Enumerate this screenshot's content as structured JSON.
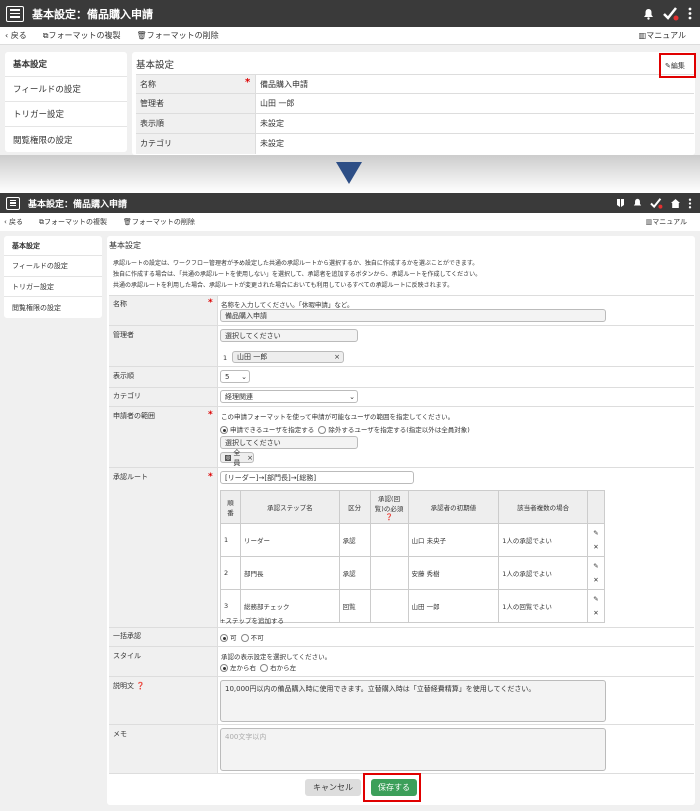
{
  "top": {
    "title": "基本設定：備品購入申請",
    "toolbar": {
      "back": "戻る",
      "copy": "フォーマットの複製",
      "delete": "フォーマットの削除",
      "manual": "マニュアル"
    },
    "sidebar": [
      "基本設定",
      "フィールドの設定",
      "トリガー設定",
      "閲覧権限の設定"
    ],
    "section_title": "基本設定",
    "edit": "編集",
    "rows": [
      {
        "label": "名称",
        "value": "備品購入申請"
      },
      {
        "label": "管理者",
        "value": "山田 一郎"
      },
      {
        "label": "表示順",
        "value": "未設定"
      },
      {
        "label": "カテゴリ",
        "value": "未設定"
      }
    ]
  },
  "bottom": {
    "title": "基本設定：備品購入申請",
    "toolbar": {
      "back": "戻る",
      "copy": "フォーマットの複製",
      "delete": "フォーマットの削除",
      "manual": "マニュアル"
    },
    "sidebar": [
      "基本設定",
      "フィールドの設定",
      "トリガー設定",
      "閲覧権限の設定"
    ],
    "section_title": "基本設定",
    "intro": [
      "承認ルートの設定は、ワークフロー管理者が予め設定した共通の承認ルートから選択するか、独自に作成するかを選ぶことができます。",
      "独自に作成する場合は、「共通の承認ルートを使用しない」を選択して、承認者を追加するボタンから、承認ルートを作成してください。",
      "共通の承認ルートを利用した場合、承認ルートが変更された場合においても利用しているすべての承認ルートに反映されます。"
    ],
    "name": {
      "label": "名称",
      "hint": "名称を入力してください。「休暇申請」など。",
      "value": "備品購入申請"
    },
    "admin": {
      "label": "管理者",
      "placeholder": "選択してください",
      "num": "1",
      "person": "山田 一郎"
    },
    "order": {
      "label": "表示順",
      "value": "5"
    },
    "category": {
      "label": "カテゴリ",
      "value": "経理関連"
    },
    "scope": {
      "label": "申請者の範囲",
      "hint": "この申請フォーマットを使って申請が可能なユーザの範囲を指定してください。",
      "opt1": "申請できるユーザを指定する",
      "opt2": "除外するユーザを指定する(指定以外は全員対象)",
      "placeholder": "選択してください",
      "chip": "全員"
    },
    "route": {
      "label": "承認ルート",
      "value": "[リーダー]→[部門長]→[総務]",
      "headers": [
        "順番",
        "承認ステップ名",
        "区分",
        "承認(回覧)の必須",
        "承認者の初期値",
        "該当者複数の場合"
      ],
      "steps": [
        {
          "no": "1",
          "name": "リーダー",
          "type": "承認",
          "approver": "山口 未央子",
          "multi": "1人の承認でよい"
        },
        {
          "no": "2",
          "name": "部門長",
          "type": "承認",
          "approver": "安藤 秀樹",
          "multi": "1人の承認でよい"
        },
        {
          "no": "3",
          "name": "総務部チェック",
          "type": "回覧",
          "approver": "山田 一郎",
          "multi": "1人の回覧でよい"
        }
      ],
      "add": "ステップを追加する"
    },
    "bulk": {
      "label": "一括承認",
      "on": "可",
      "off": "不可"
    },
    "style": {
      "label": "スタイル",
      "hint": "承認の表示設定を選択してください。",
      "opt1": "左から右",
      "opt2": "右から左"
    },
    "desc": {
      "label": "説明文",
      "value": "10,000円以内の備品購入時に使用できます。立替購入時は「立替経費精算」を使用してください。"
    },
    "memo": {
      "label": "メモ",
      "placeholder": "400文字以内"
    },
    "cancel": "キャンセル",
    "save": "保存する"
  }
}
